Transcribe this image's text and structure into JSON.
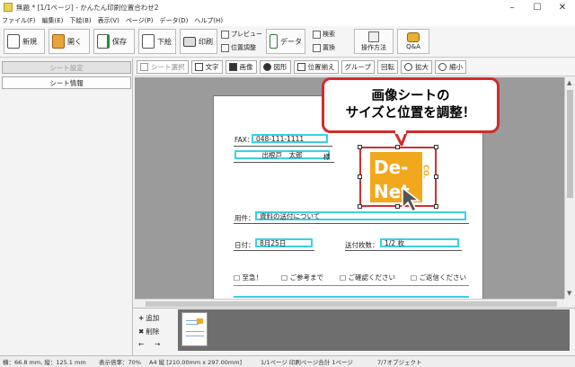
{
  "window": {
    "title": "無題 * [1/1ページ] - かんたん印刷位置合わせ2"
  },
  "menu": [
    "ファイル(F)",
    "編集(E)",
    "下絵(B)",
    "表示(V)",
    "ページ(P)",
    "データ(D)",
    "ヘルプ(H)"
  ],
  "toolbar": {
    "new": "新規",
    "open": "開く",
    "save": "保存",
    "underlay": "下絵",
    "print": "印刷",
    "preview": "プレビュー",
    "position_adjust": "位置調整",
    "data": "データ",
    "search": "検索",
    "replace": "置換",
    "howto": "操作方法",
    "qa": "Q&A"
  },
  "sidebar": {
    "sheet_settings": "シート設定",
    "sheet_info": "シート情報"
  },
  "objbar": {
    "select": "シート選択",
    "text": "文字",
    "image": "画像",
    "shape": "図形",
    "align": "位置揃え",
    "group": "グループ",
    "rotate": "回転",
    "zoom_in": "拡大",
    "zoom_out": "縮小"
  },
  "callout": {
    "line1": "画像シートの",
    "line2": "サイズと位置を調整！"
  },
  "form": {
    "fax_label": "FAX：",
    "fax_value": "048-111-1111",
    "name_value": "出根戸　太郎",
    "honorific": "様",
    "subject_label": "用件：",
    "subject_value": "資料の送付について",
    "date_label": "日付：",
    "date_value": "8月25日",
    "pages_label": "送付枚数：",
    "pages_value": "1/2 枚",
    "check_urgent": "□ 至急！",
    "check_ref": "□ ご参考まで",
    "check_confirm": "□ ご確認ください",
    "check_reply": "□ ご返信ください"
  },
  "logo": {
    "line1": "De-",
    "line2": "Net",
    "side": "CO."
  },
  "thumbs": {
    "add": "追加",
    "delete": "削除",
    "prev_arrow": "←",
    "next_arrow": "→"
  },
  "status": {
    "coords": "横：66.8 mm, 縦：125.1 mm",
    "zoom": "表示倍率：70%",
    "paper": "A4 縦 [210.00mm x 297.00mm]",
    "page_info": "1/1ページ 印刷ページ合計 1ページ",
    "objects": "7/7オブジェクト"
  },
  "colors": {
    "field_border": "#3ad0e8",
    "highlight": "#d32f2f",
    "logo_orange": "#f2a81d"
  }
}
